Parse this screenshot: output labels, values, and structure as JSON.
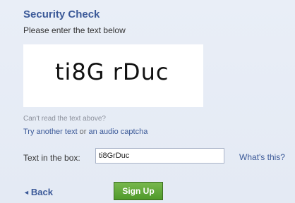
{
  "dialog": {
    "title": "Security Check",
    "subtitle": "Please enter the text below",
    "captcha_text": "ti8G rDuc"
  },
  "help": {
    "cant_read": "Can't read the text above?",
    "try_another": "Try another text",
    "or": " or ",
    "audio": "an audio captcha"
  },
  "form": {
    "label": "Text in the box:",
    "value": "ti8GrDuc",
    "whats_this": "What's this?"
  },
  "actions": {
    "back_arrow": "◄",
    "back_label": "Back",
    "signup_label": "Sign Up"
  },
  "colors": {
    "background": "#e8edf6",
    "link": "#3b5998",
    "signup_button": "#5fa636"
  }
}
